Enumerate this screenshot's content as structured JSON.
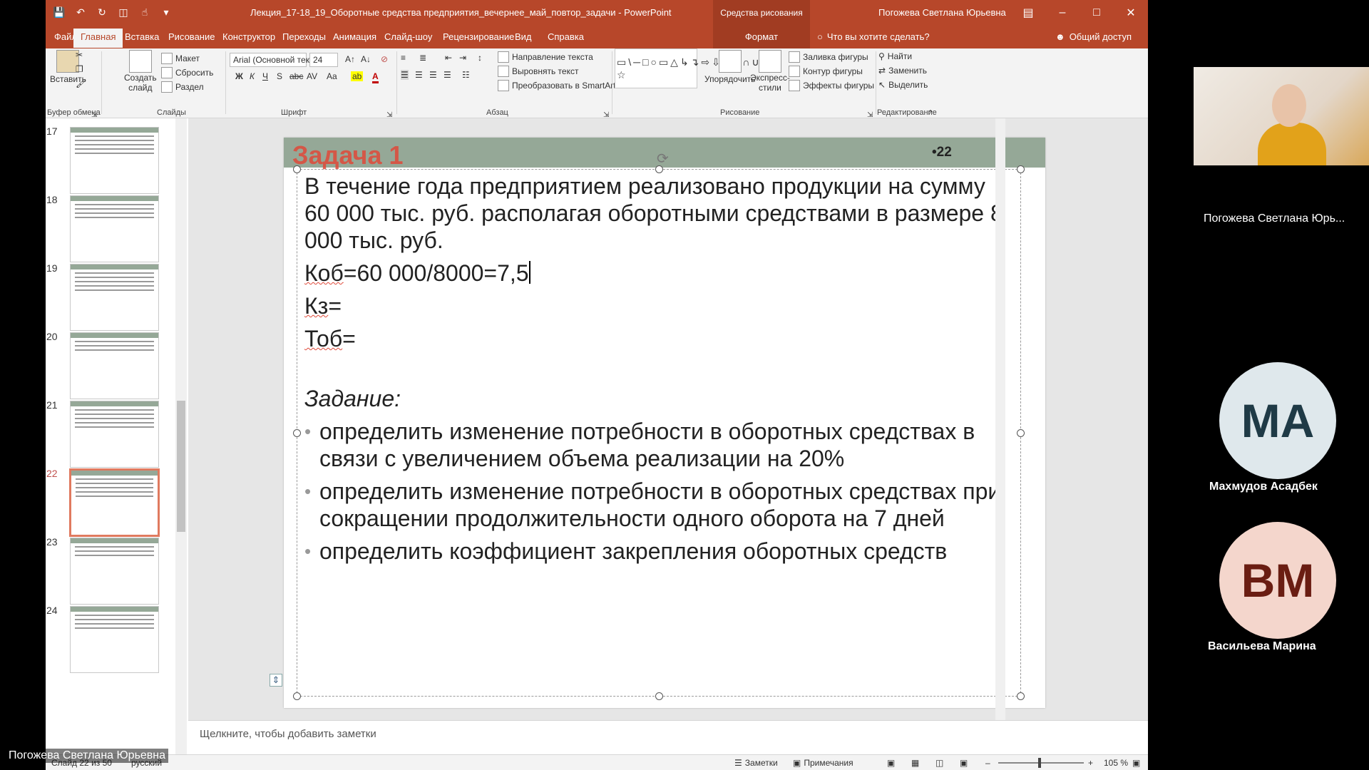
{
  "window": {
    "doc_title": "Лекция_17-18_19_Оборотные средства предприятия_вечернее_май_повтор_задачи - PowerPoint",
    "context_tab_group": "Средства рисования",
    "user": "Погожева Светлана Юрьевна"
  },
  "tabs": [
    {
      "label": "Файл"
    },
    {
      "label": "Главная"
    },
    {
      "label": "Вставка"
    },
    {
      "label": "Рисование"
    },
    {
      "label": "Конструктор"
    },
    {
      "label": "Переходы"
    },
    {
      "label": "Анимация"
    },
    {
      "label": "Слайд-шоу"
    },
    {
      "label": "Рецензирование"
    },
    {
      "label": "Вид"
    },
    {
      "label": "Справка"
    }
  ],
  "format_tab": "Формат",
  "tell_me": "Что вы хотите сделать?",
  "share": "Общий доступ",
  "ribbon": {
    "clipboard": {
      "paste": "Вставить",
      "label": "Буфер обмена"
    },
    "slides": {
      "new_slide_1": "Создать",
      "new_slide_2": "слайд",
      "layout": "Макет",
      "reset": "Сбросить",
      "section": "Раздел",
      "label": "Слайды"
    },
    "font": {
      "name": "Arial (Основной текс",
      "size": "24",
      "label": "Шрифт"
    },
    "paragraph": {
      "text_direction": "Направление текста",
      "align_text": "Выровнять текст",
      "convert_smartart": "Преобразовать в SmartArt",
      "label": "Абзац"
    },
    "drawing": {
      "arrange": "Упорядочить",
      "quick_styles_1": "Экспресс-",
      "quick_styles_2": "стили",
      "shape_fill": "Заливка фигуры",
      "shape_outline": "Контур фигуры",
      "shape_effects": "Эффекты фигуры",
      "label": "Рисование"
    },
    "editing": {
      "find": "Найти",
      "replace": "Заменить",
      "select": "Выделить",
      "label": "Редактирование"
    }
  },
  "thumbnails": [
    {
      "num": "17"
    },
    {
      "num": "18"
    },
    {
      "num": "19"
    },
    {
      "num": "20"
    },
    {
      "num": "21"
    },
    {
      "num": "22"
    },
    {
      "num": "23"
    },
    {
      "num": "24"
    }
  ],
  "selected_slide": "22",
  "slide": {
    "title": "Задача 1",
    "number": "•22",
    "intro": "В течение года предприятием реализовано продукции на сумму 60 000 тыс. руб. располагая оборотными средствами в размере 8 000 тыс. руб.",
    "kob_label": "Коб",
    "kob_value": "=60 000/8000=7,5",
    "kz_label": "Кз",
    "kz_value": "=",
    "tob_label": "Тоб",
    "tob_value": "=",
    "task_heading": "Задание:",
    "bullets": [
      "определить изменение потребности в оборотных средствах в связи с увеличением объема реализации на 20%",
      "определить изменение потребности в оборотных средствах при сокращении продолжительности одного оборота на 7 дней",
      "определить коэффициент закрепления оборотных средств"
    ]
  },
  "notes_placeholder": "Щелкните, чтобы добавить заметки",
  "status": {
    "slide_info": "Слайд 22 из 50",
    "language": "русский",
    "notes": "Заметки",
    "comments": "Примечания",
    "zoom": "105 %"
  },
  "presenter_label": "Погожева Светлана Юрьевна",
  "participants": [
    {
      "name": "Погожева Светлана Юрь...",
      "kind": "video"
    },
    {
      "initials": "MA",
      "name": "Махмудов Асадбек",
      "bg": "#dfe8ec",
      "fg": "#1f3a46"
    },
    {
      "initials": "BM",
      "name": "Васильева Марина",
      "bg": "#f4d6cc",
      "fg": "#6a1d12"
    }
  ]
}
